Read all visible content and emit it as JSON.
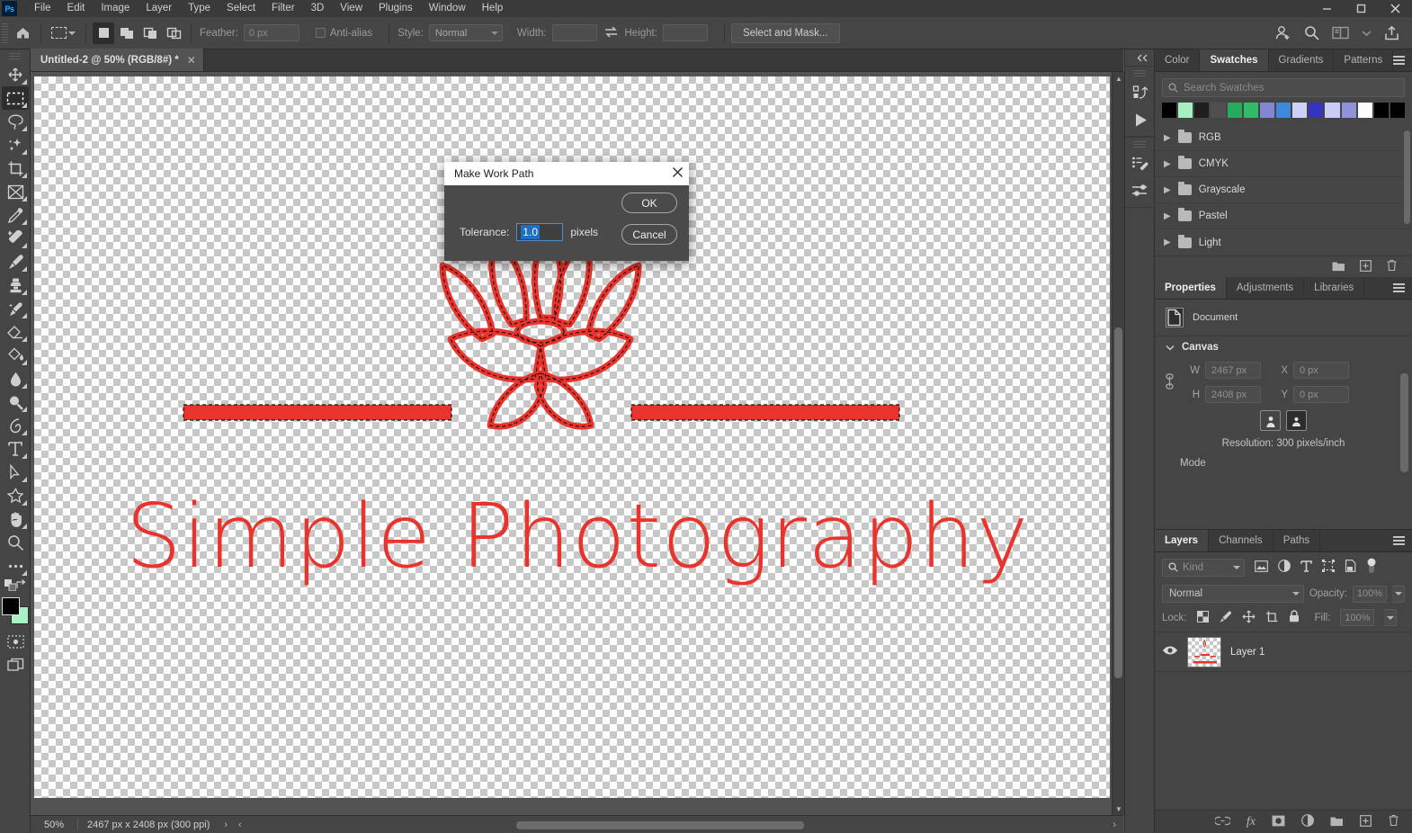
{
  "app": {
    "name": "Ps",
    "logo_text": "Ps"
  },
  "titlebar": {
    "menus": [
      "File",
      "Edit",
      "Image",
      "Layer",
      "Type",
      "Select",
      "Filter",
      "3D",
      "View",
      "Plugins",
      "Window",
      "Help"
    ],
    "window_controls": {
      "minimize": "–",
      "maximize": "☐",
      "close": "✕"
    }
  },
  "options_bar": {
    "home_icon": "home-icon",
    "tool_icon": "rectangular-marquee-icon",
    "selection_modes": [
      "new-selection",
      "add-to-selection",
      "subtract-from-selection",
      "intersect-with-selection"
    ],
    "feather_label": "Feather:",
    "feather_value": "0 px",
    "antialias_label": "Anti-alias",
    "style_label": "Style:",
    "style_value": "Normal",
    "width_label": "Width:",
    "width_value": "",
    "swap_icon": "swap-width-height-icon",
    "height_label": "Height:",
    "height_value": "",
    "select_and_mask": "Select and Mask...",
    "right_icons": [
      "share-user-icon",
      "search-icon",
      "workspace-icon",
      "chevron-down-icon",
      "export-icon"
    ]
  },
  "toolbar": {
    "tools": [
      {
        "name": "move-tool",
        "active": false
      },
      {
        "name": "rectangular-marquee-tool",
        "active": true
      },
      {
        "name": "lasso-tool",
        "active": false
      },
      {
        "name": "object-selection-tool",
        "active": false
      },
      {
        "name": "crop-tool",
        "active": false
      },
      {
        "name": "frame-tool",
        "active": false
      },
      {
        "name": "eyedropper-tool",
        "active": false
      },
      {
        "name": "spot-healing-brush-tool",
        "active": false
      },
      {
        "name": "brush-tool",
        "active": false
      },
      {
        "name": "clone-stamp-tool",
        "active": false
      },
      {
        "name": "history-brush-tool",
        "active": false
      },
      {
        "name": "eraser-tool",
        "active": false
      },
      {
        "name": "gradient-tool",
        "active": false
      },
      {
        "name": "blur-tool",
        "active": false
      },
      {
        "name": "dodge-tool",
        "active": false
      },
      {
        "name": "pen-tool",
        "active": false
      },
      {
        "name": "type-tool",
        "active": false
      },
      {
        "name": "path-selection-tool",
        "active": false
      },
      {
        "name": "shape-tool",
        "active": false
      },
      {
        "name": "hand-tool",
        "active": false
      },
      {
        "name": "zoom-tool",
        "active": false
      },
      {
        "name": "edit-toolbar-tool",
        "active": false
      }
    ],
    "foreground_color": "#000000",
    "background_color": "#a8f0c6",
    "quickmask_icon": "quick-mask-icon",
    "screenmode_icon": "screen-mode-icon"
  },
  "document": {
    "tab_title": "Untitled-2 @ 50% (RGB/8#) *",
    "close_icon": "✕"
  },
  "canvas": {
    "artwork_text": "Simple Photography",
    "artwork_color": "#e8342c",
    "logo_name": "lotus-flower-logo"
  },
  "status_bar": {
    "zoom": "50%",
    "doc_size": "2467 px x 2408 px (300 ppi)",
    "next_arrow": "›",
    "prev_arrow": "‹"
  },
  "mini_dock": {
    "collapse_icon": "«",
    "buttons": [
      "actions-icon",
      "play-icon",
      "styles-icon",
      "adjustments-presets-icon"
    ]
  },
  "swatches_panel": {
    "tabs": [
      {
        "label": "Color",
        "active": false
      },
      {
        "label": "Swatches",
        "active": true
      },
      {
        "label": "Gradients",
        "active": false
      },
      {
        "label": "Patterns",
        "active": false
      }
    ],
    "menu_icon": "panel-menu-icon",
    "search_placeholder": "Search Swatches",
    "search_icon": "search-icon",
    "recent_colors": [
      "#000000",
      "#a5f0be",
      "#1e1e1e",
      "#4f4f4f",
      "#22ac5c",
      "#2fbd68",
      "#8287d2",
      "#3f86df",
      "#cdd1f6",
      "#3434c0",
      "#c9ccf5",
      "#8f92d8",
      "#fdfdfb",
      "#000000",
      "#000000"
    ],
    "groups": [
      {
        "label": "RGB"
      },
      {
        "label": "CMYK"
      },
      {
        "label": "Grayscale"
      },
      {
        "label": "Pastel"
      },
      {
        "label": "Light"
      }
    ],
    "footer_icons": [
      "new-group-icon",
      "new-swatch-icon",
      "delete-swatch-icon"
    ]
  },
  "properties_panel": {
    "tabs": [
      {
        "label": "Properties",
        "active": true
      },
      {
        "label": "Adjustments",
        "active": false
      },
      {
        "label": "Libraries",
        "active": false
      }
    ],
    "menu_icon": "panel-menu-icon",
    "document_label": "Document",
    "document_icon": "document-icon",
    "section_title": "Canvas",
    "link_icon": "link-dimensions-icon",
    "w_label": "W",
    "w_value": "2467 px",
    "h_label": "H",
    "h_value": "2408 px",
    "x_label": "X",
    "x_value": "0 px",
    "y_label": "Y",
    "y_value": "0 px",
    "orientation_portrait": "portrait-orientation-icon",
    "orientation_landscape": "landscape-orientation-icon",
    "resolution": "Resolution: 300 pixels/inch",
    "mode_label": "Mode"
  },
  "layers_panel": {
    "tabs": [
      {
        "label": "Layers",
        "active": true
      },
      {
        "label": "Channels",
        "active": false
      },
      {
        "label": "Paths",
        "active": false
      }
    ],
    "menu_icon": "panel-menu-icon",
    "filter_label": "Kind",
    "filter_icons": [
      "filter-pixel-icon",
      "filter-adjustment-icon",
      "filter-type-icon",
      "filter-shape-icon",
      "filter-smart-object-icon"
    ],
    "filter_toggle_icon": "filter-toggle-icon",
    "blend_mode": "Normal",
    "opacity_label": "Opacity:",
    "opacity_value": "100%",
    "lock_label": "Lock:",
    "lock_icons": [
      "lock-transparent-pixels-icon",
      "lock-image-pixels-icon",
      "lock-position-icon",
      "lock-artboard-icon",
      "lock-all-icon"
    ],
    "fill_label": "Fill:",
    "fill_value": "100%",
    "layers": [
      {
        "name": "Layer 1",
        "visible": true,
        "visibility_icon": "eye-icon"
      }
    ],
    "footer_icons": [
      "link-layers-icon",
      "layer-fx-icon",
      "add-layer-mask-icon",
      "new-adjustment-layer-icon",
      "new-group-icon",
      "new-layer-icon",
      "delete-layer-icon"
    ]
  },
  "dialog": {
    "title": "Make Work Path",
    "close_icon": "✕",
    "tolerance_label": "Tolerance:",
    "tolerance_value": "1.0",
    "units": "pixels",
    "ok_label": "OK",
    "cancel_label": "Cancel"
  }
}
